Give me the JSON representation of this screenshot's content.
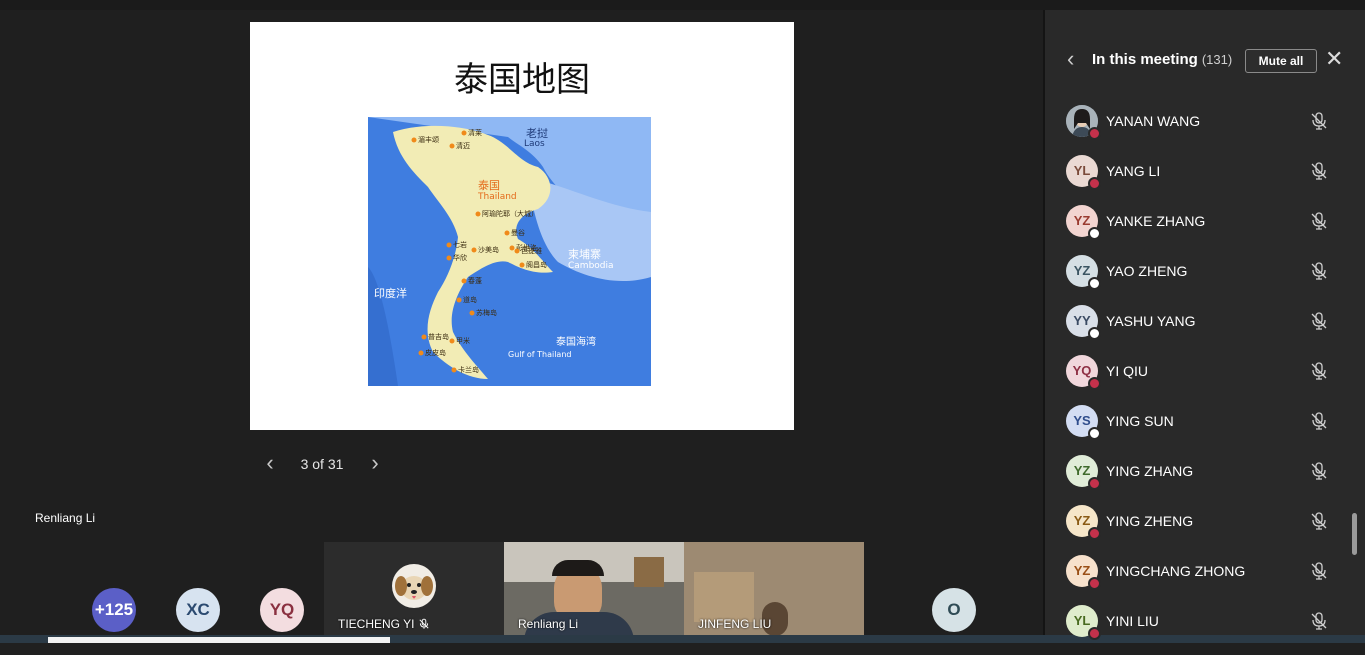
{
  "slide": {
    "title": "泰国地图",
    "map_labels": {
      "laos_cn": "老挝",
      "laos_en": "Laos",
      "thailand_cn": "泰国",
      "thailand_en": "Thailand",
      "cambodia_cn": "柬埔寨",
      "cambodia_en": "Cambodia",
      "indian_ocean_cn": "印度洋",
      "gulf_cn": "泰国海湾",
      "gulf_en": "Gulf of Thailand",
      "cities": [
        "清莱",
        "清迈",
        "湄丰颂",
        "阿瑜陀耶（大城）",
        "曼谷",
        "彭世洛",
        "七岩",
        "华欣",
        "沙美岛",
        "芭提雅",
        "阁昌岛",
        "春蓬",
        "道岛",
        "苏梅岛",
        "普吉岛",
        "甲米",
        "皮皮岛",
        "卡兰岛"
      ]
    }
  },
  "slide_nav": {
    "prev_icon": "chevron-left-icon",
    "next_icon": "chevron-right-icon",
    "counter": "3 of 31"
  },
  "presenter": {
    "name": "Renliang Li"
  },
  "gallery": {
    "overflow": {
      "label": "+125",
      "bg": "#5b5fc7"
    },
    "avatars": [
      {
        "initials": "XC",
        "bg": "#d7e3f0",
        "fg": "#2b4a70"
      },
      {
        "initials": "YQ",
        "bg": "#f3dde0",
        "fg": "#8a3040"
      },
      {
        "initials": "O",
        "bg": "#d6e2e6",
        "fg": "#2f4b55"
      }
    ],
    "videos": [
      {
        "name": "TIECHENG YI",
        "muted": true
      },
      {
        "name": "Renliang Li"
      },
      {
        "name": "JINFENG LIU"
      }
    ]
  },
  "panel": {
    "back_icon": "chevron-left-icon",
    "title": "In this meeting",
    "count": "(131)",
    "mute_all": "Mute all",
    "close_icon": "close-icon",
    "participants": [
      {
        "initials": "",
        "name": "YANAN WANG",
        "photo": true,
        "status": "busy",
        "bg": "#6f7c86",
        "fg": "#fff"
      },
      {
        "initials": "YL",
        "name": "YANG LI",
        "status": "busy",
        "bg": "#ead9d3",
        "fg": "#7a4a3a"
      },
      {
        "initials": "YZ",
        "name": "YANKE ZHANG",
        "status": "offline",
        "bg": "#f2d4d0",
        "fg": "#9a3a2f"
      },
      {
        "initials": "YZ",
        "name": "YAO ZHENG",
        "status": "offline",
        "bg": "#d5dfe4",
        "fg": "#3b5562"
      },
      {
        "initials": "YY",
        "name": "YASHU YANG",
        "status": "offline",
        "bg": "#d9dfe8",
        "fg": "#3a4a63"
      },
      {
        "initials": "YQ",
        "name": "YI QIU",
        "status": "busy",
        "bg": "#f1d7dc",
        "fg": "#8e2f44"
      },
      {
        "initials": "YS",
        "name": "YING SUN",
        "status": "offline",
        "bg": "#d3ddf3",
        "fg": "#2f4d8c"
      },
      {
        "initials": "YZ",
        "name": "YING ZHANG",
        "status": "busy",
        "bg": "#e0ecd8",
        "fg": "#3f6a2c"
      },
      {
        "initials": "YZ",
        "name": "YING ZHENG",
        "status": "busy",
        "bg": "#f6e6c9",
        "fg": "#8a5a14"
      },
      {
        "initials": "YZ",
        "name": "YINGCHANG ZHONG",
        "status": "busy",
        "bg": "#f7e1cc",
        "fg": "#9a4f16"
      },
      {
        "initials": "YL",
        "name": "YINI LIU",
        "status": "busy",
        "bg": "#dfeccc",
        "fg": "#486a1f"
      }
    ],
    "status_colors": {
      "busy": "#c4314b",
      "offline": "#ffffff"
    },
    "mic_icon": "mic-off-icon"
  }
}
